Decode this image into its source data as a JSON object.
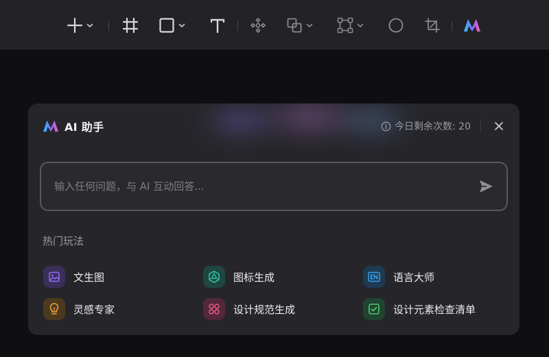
{
  "toolbar": {
    "tools": [
      {
        "name": "add-tool",
        "icon": "plus-icon",
        "dropdown": true
      },
      {
        "name": "frame-tool",
        "icon": "frame-icon",
        "dropdown": false
      },
      {
        "name": "rectangle-tool",
        "icon": "rectangle-icon",
        "dropdown": true
      },
      {
        "name": "text-tool",
        "icon": "text-icon",
        "dropdown": false
      },
      {
        "name": "component-tool",
        "icon": "component-icon",
        "dropdown": false
      },
      {
        "name": "boolean-tool",
        "icon": "boolean-icon",
        "dropdown": true
      },
      {
        "name": "vector-tool",
        "icon": "vector-path-icon",
        "dropdown": true
      },
      {
        "name": "mask-tool",
        "icon": "circle-mask-icon",
        "dropdown": false
      },
      {
        "name": "crop-tool",
        "icon": "crop-icon",
        "dropdown": false
      },
      {
        "name": "ai-tool",
        "icon": "ai-logo-icon",
        "dropdown": false
      }
    ]
  },
  "panel": {
    "title": "AI 助手",
    "quota_text": "今日剩余次数: 20",
    "input_placeholder": "输入任何问题，与 AI 互动回答...",
    "section_title": "热门玩法",
    "features": [
      {
        "label": "文生图",
        "icon": "image-icon",
        "color": "#8f6bff",
        "bg": "#3a2f58"
      },
      {
        "label": "图标生成",
        "icon": "aperture-icon",
        "color": "#30c2a0",
        "bg": "#1f4640"
      },
      {
        "label": "语言大师",
        "icon": "en-badge-icon",
        "color": "#3aa0e8",
        "bg": "#1d3a52"
      },
      {
        "label": "灵感专家",
        "icon": "lightbulb-icon",
        "color": "#f0a43a",
        "bg": "#4c3a20"
      },
      {
        "label": "设计规范生成",
        "icon": "grid-circles-icon",
        "color": "#ef5c82",
        "bg": "#52283a"
      },
      {
        "label": "设计元素检查清单",
        "icon": "checkbox-icon",
        "color": "#4cc870",
        "bg": "#214430"
      }
    ]
  },
  "colors": {
    "background": "#0f0f11",
    "toolbar": "#232326",
    "panel": "#26262a",
    "icon": "#d8d8dc",
    "icon_dim": "#8a8a90"
  }
}
